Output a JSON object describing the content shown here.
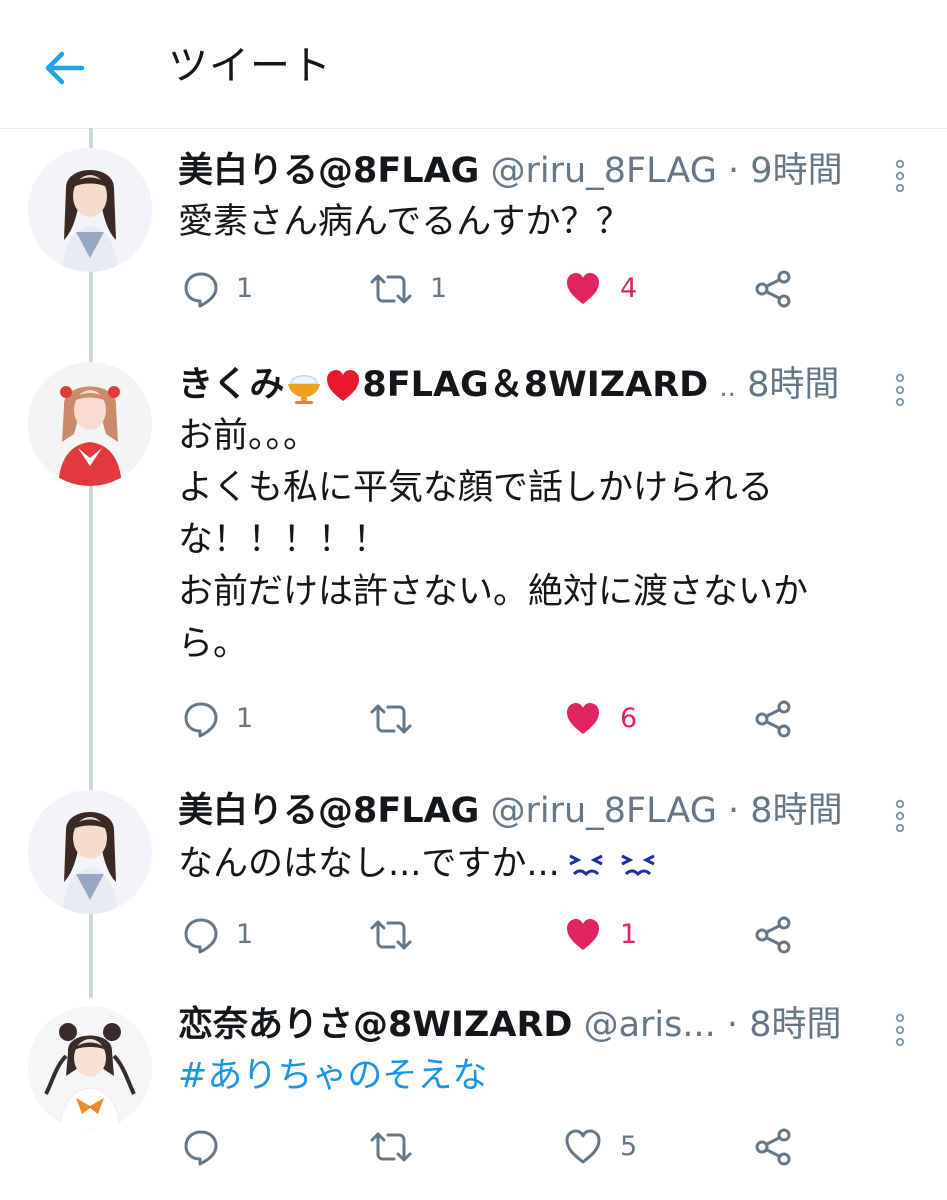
{
  "header": {
    "title": "ツイート"
  },
  "tweets": [
    {
      "name": "美白りる@8FLAG",
      "handle": "@riru_8FLAG",
      "dot": "·",
      "time": "9時間",
      "lines": [
        "愛素さん病んでるんすか？？"
      ],
      "replies": "1",
      "retweets": "1",
      "likes": "4",
      "liked": true
    },
    {
      "name": "きくみ",
      "name_suffix": "8FLAG＆8WIZARD",
      "handle": "..",
      "time": "8時間",
      "name_emoji": [
        "shaved-ice-emoji",
        "red-heart-emoji"
      ],
      "lines": [
        "お前。。。",
        "よくも私に平気な顔で話しかけられる",
        "な！！！！！",
        "お前だけは許さない。絶対に渡さないか",
        "ら。"
      ],
      "replies": "1",
      "retweets": "",
      "likes": "6",
      "liked": true
    },
    {
      "name": "美白りる@8FLAG",
      "handle": "@riru_8FLAG",
      "dot": "·",
      "time": "8時間",
      "lines": [
        "なんのはなし...ですか..."
      ],
      "text_emoji": [
        "persevering-face-emoji",
        "persevering-face-emoji"
      ],
      "replies": "1",
      "retweets": "",
      "likes": "1",
      "liked": true
    },
    {
      "name": "恋奈ありさ@8WIZARD",
      "handle": "@aris...",
      "dot": "·",
      "time": "8時間",
      "lines": [
        "#ありちゃのそえな"
      ],
      "replies": "",
      "retweets": "",
      "likes": "5",
      "liked": false
    }
  ],
  "colors": {
    "accent": "#1da1f2",
    "hashtag": "#1b95e0",
    "like": "#e0245e",
    "muted": "#657786",
    "divider": "#e6ecf0"
  }
}
